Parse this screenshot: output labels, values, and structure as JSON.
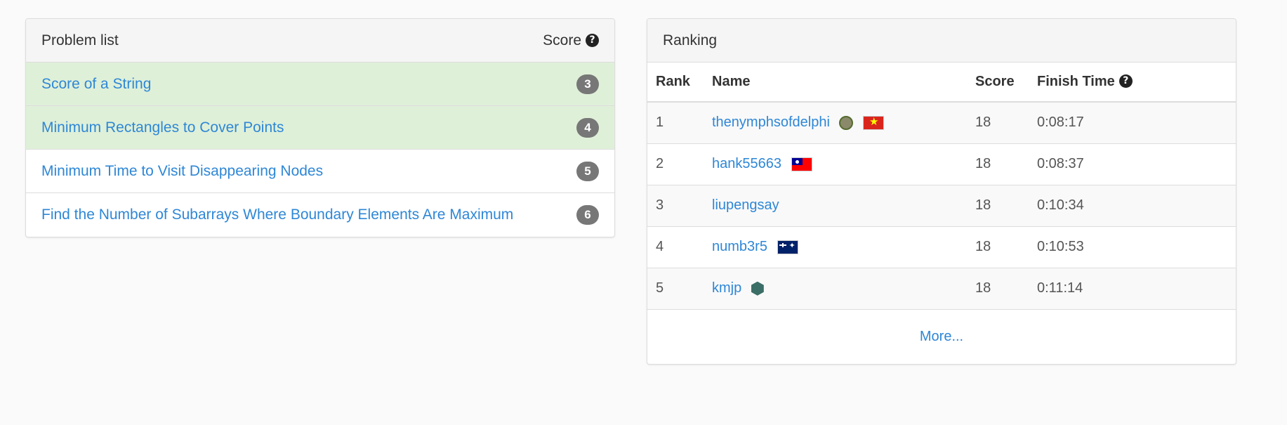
{
  "problems": {
    "title": "Problem list",
    "score_header": "Score",
    "help_glyph": "?",
    "items": [
      {
        "title": "Score of a String",
        "score": "3",
        "solved": true
      },
      {
        "title": "Minimum Rectangles to Cover Points",
        "score": "4",
        "solved": true
      },
      {
        "title": "Minimum Time to Visit Disappearing Nodes",
        "score": "5",
        "solved": false
      },
      {
        "title": "Find the Number of Subarrays Where Boundary Elements Are Maximum",
        "score": "6",
        "solved": false
      }
    ]
  },
  "ranking": {
    "title": "Ranking",
    "columns": {
      "rank": "Rank",
      "name": "Name",
      "score": "Score",
      "finish_time": "Finish Time"
    },
    "help_glyph": "?",
    "rows": [
      {
        "rank": "1",
        "name": "thenymphsofdelphi",
        "score": "18",
        "time": "0:08:17",
        "icons": [
          "badge-icon",
          "vietnam-flag-icon"
        ]
      },
      {
        "rank": "2",
        "name": "hank55663",
        "score": "18",
        "time": "0:08:37",
        "icons": [
          "taiwan-flag-icon"
        ]
      },
      {
        "rank": "3",
        "name": "liupengsay",
        "score": "18",
        "time": "0:10:34",
        "icons": []
      },
      {
        "rank": "4",
        "name": "numb3r5",
        "score": "18",
        "time": "0:10:53",
        "icons": [
          "australia-flag-icon"
        ]
      },
      {
        "rank": "5",
        "name": "kmjp",
        "score": "18",
        "time": "0:11:14",
        "icons": [
          "hexagon-badge-icon"
        ]
      }
    ],
    "more_label": "More..."
  },
  "colors": {
    "link": "#2e87d6",
    "solved_row": "#dff0d8",
    "badge": "#777777"
  }
}
